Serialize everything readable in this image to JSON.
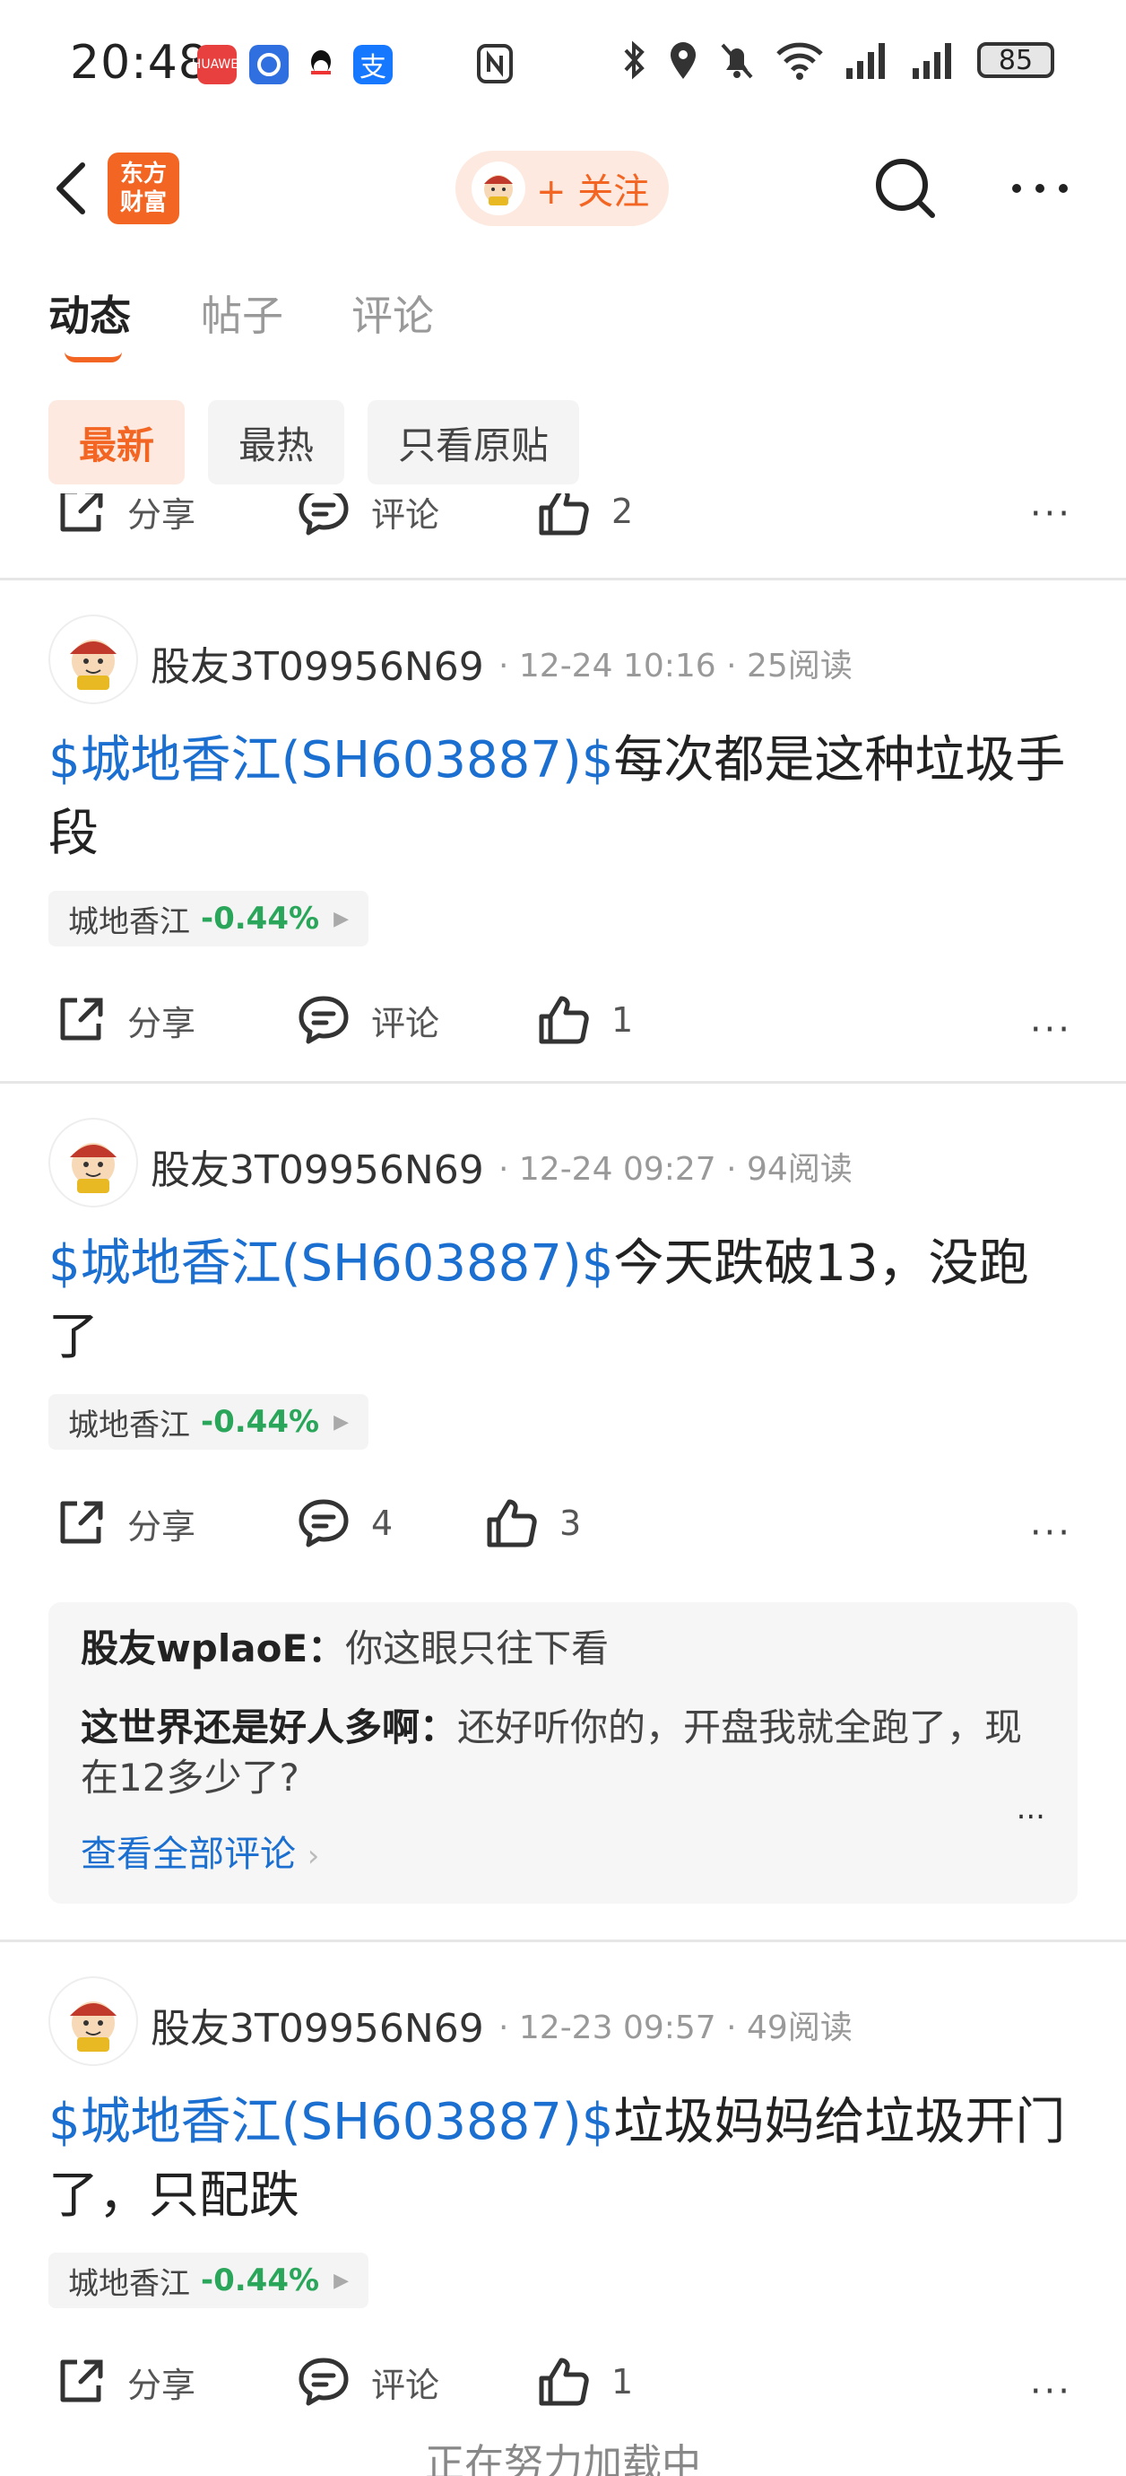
{
  "status_bar": {
    "time": "20:48",
    "app_badges": [
      "HUAWEI",
      "",
      "",
      "支"
    ],
    "battery": "85"
  },
  "header": {
    "logo_text_line1": "东方",
    "logo_text_line2": "财富",
    "follow_label": "+ 关注"
  },
  "tabs": [
    {
      "label": "动态",
      "active": true
    },
    {
      "label": "帖子",
      "active": false
    },
    {
      "label": "评论",
      "active": false
    }
  ],
  "filters": [
    {
      "label": "最新",
      "active": true
    },
    {
      "label": "最热",
      "active": false
    },
    {
      "label": "只看原贴",
      "active": false
    }
  ],
  "partial_post": {
    "share": "分享",
    "comment": "评论",
    "likes": "2"
  },
  "posts": [
    {
      "username": "股友3T09956N69",
      "meta": "· 12-24 10:16 · 25阅读",
      "stock_link": "$城地香江(SH603887)$",
      "text": "每次都是这种垃圾手段",
      "tag_name": "城地香江",
      "tag_change": "-0.44%",
      "share": "分享",
      "comment": "评论",
      "likes": "1"
    },
    {
      "username": "股友3T09956N69",
      "meta": "· 12-24 09:27 · 94阅读",
      "stock_link": "$城地香江(SH603887)$",
      "text": "今天跌破13，没跑了",
      "tag_name": "城地香江",
      "tag_change": "-0.44%",
      "share": "分享",
      "comment": "4",
      "likes": "3",
      "comments": [
        {
          "name": "股友wplaoE：",
          "text": "你这眼只往下看"
        },
        {
          "name": "这世界还是好人多啊：",
          "text": "还好听你的，开盘我就全跑了，现在12多少了?"
        }
      ],
      "view_all": "查看全部评论"
    },
    {
      "username": "股友3T09956N69",
      "meta": "· 12-23 09:57 · 49阅读",
      "stock_link": "$城地香江(SH603887)$",
      "text": "垃圾妈妈给垃圾开门了，只配跌",
      "tag_name": "城地香江",
      "tag_change": "-0.44%",
      "share": "分享",
      "comment": "评论",
      "likes": "1"
    }
  ],
  "loading": "正在努力加载中"
}
